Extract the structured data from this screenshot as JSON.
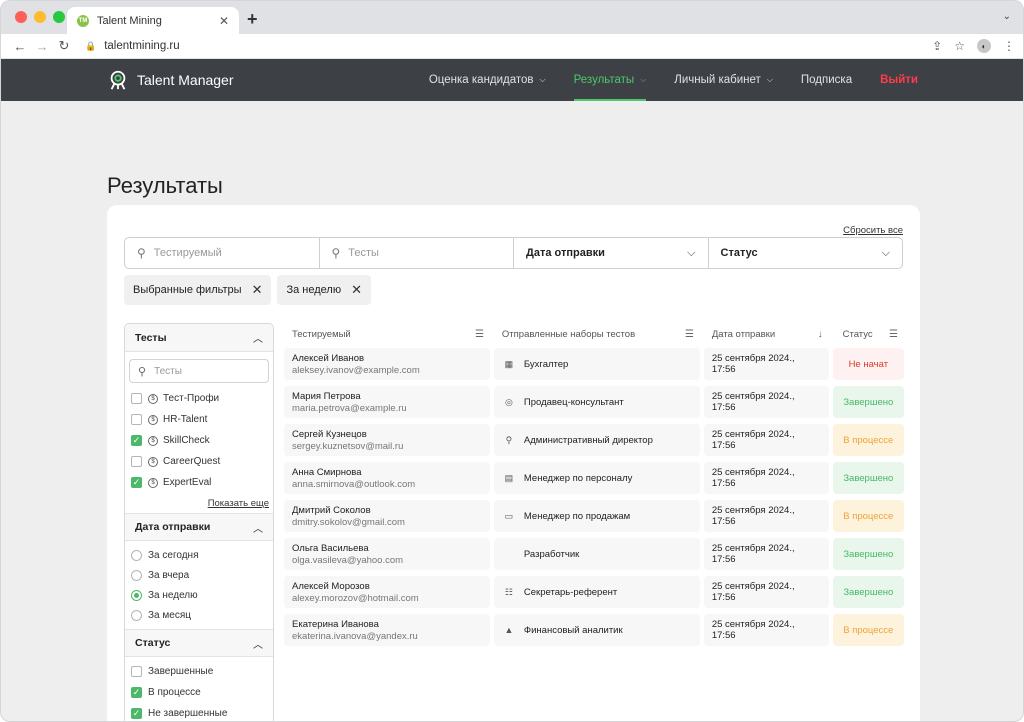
{
  "browser": {
    "tab_title": "Talent Mining",
    "favicon_text": "TM",
    "url": "talentmining.ru"
  },
  "site": {
    "logo_text": "Talent Manager",
    "menu": [
      {
        "label": "Оценка кандидатов",
        "has_chevron": true
      },
      {
        "label": "Результаты",
        "has_chevron": true,
        "active": true
      },
      {
        "label": "Личный кабинет",
        "has_chevron": true
      },
      {
        "label": "Подписка",
        "has_chevron": false
      },
      {
        "label": "Выйти",
        "has_chevron": false
      }
    ]
  },
  "page": {
    "title": "Результаты",
    "reset_all": "Сбросить все"
  },
  "filters": {
    "tested_placeholder": "Тестируемый",
    "tests_placeholder": "Тесты",
    "date_label": "Дата отправки",
    "status_label": "Статус"
  },
  "chips": [
    "Выбранные фильтры",
    "За неделю"
  ],
  "sidebar": {
    "tests_heading": "Тесты",
    "tests_search_placeholder": "Тесты",
    "tests": [
      {
        "label": "Тест-Профи",
        "checked": false
      },
      {
        "label": "HR-Talent",
        "checked": false
      },
      {
        "label": "SkillCheck",
        "checked": true
      },
      {
        "label": "CareerQuest",
        "checked": false
      },
      {
        "label": "ExpertEval",
        "checked": true
      }
    ],
    "show_more": "Показать еще",
    "date_heading": "Дата отправки",
    "dates": [
      {
        "label": "За сегодня",
        "selected": false
      },
      {
        "label": "За вчера",
        "selected": false
      },
      {
        "label": "За неделю",
        "selected": true
      },
      {
        "label": "За месяц",
        "selected": false
      }
    ],
    "status_heading": "Статус",
    "statuses": [
      {
        "label": "Завершенные",
        "checked": false
      },
      {
        "label": "В процессе",
        "checked": true
      },
      {
        "label": "Не завершенные",
        "checked": true
      }
    ]
  },
  "table": {
    "headers": {
      "tested": "Тестируемый",
      "tests": "Отправленные наборы тестов",
      "date": "Дата отправки",
      "status": "Статус"
    },
    "rows": [
      {
        "name": "Алексей Иванов",
        "email": "aleksey.ivanov@example.com",
        "test": "Бухгалтер",
        "icon": "calculator-icon",
        "date": "25 сентября 2024., 17:56",
        "status": "Не начат",
        "status_kind": "not"
      },
      {
        "name": "Мария Петрова",
        "email": "maria.petrova@example.ru",
        "test": "Продавец-консультант",
        "icon": "coin-icon",
        "date": "25 сентября 2024., 17:56",
        "status": "Завершено",
        "status_kind": "done"
      },
      {
        "name": "Сергей Кузнецов",
        "email": "sergey.kuznetsov@mail.ru",
        "test": "Административный директор",
        "icon": "person-icon",
        "date": "25 сентября 2024., 17:56",
        "status": "В процессе",
        "status_kind": "prog"
      },
      {
        "name": "Анна Смирнова",
        "email": "anna.smirnova@outlook.com",
        "test": "Менеджер по персоналу",
        "icon": "folder-icon",
        "date": "25 сентября 2024., 17:56",
        "status": "Завершено",
        "status_kind": "done"
      },
      {
        "name": "Дмитрий Соколов",
        "email": "dmitry.sokolov@gmail.com",
        "test": "Менеджер по продажам",
        "icon": "monitor-icon",
        "date": "25 сентября 2024., 17:56",
        "status": "В процессе",
        "status_kind": "prog"
      },
      {
        "name": "Ольга Васильева",
        "email": "olga.vasileva@yahoo.com",
        "test": "Разработчик",
        "icon": "code-icon",
        "date": "25 сентября 2024., 17:56",
        "status": "Завершено",
        "status_kind": "done"
      },
      {
        "name": "Алексей Морозов",
        "email": "alexey.morozov@hotmail.com",
        "test": "Секретарь-референт",
        "icon": "list-icon",
        "date": "25 сентября 2024., 17:56",
        "status": "Завершено",
        "status_kind": "done"
      },
      {
        "name": "Екатерина Иванова",
        "email": "ekaterina.ivanova@yandex.ru",
        "test": "Финансовый аналитик",
        "icon": "chart-icon",
        "date": "25 сентября 2024., 17:56",
        "status": "В процессе",
        "status_kind": "prog"
      }
    ]
  },
  "colors": {
    "header_bg": "#3d4045",
    "accent_green": "#4cc96b",
    "logout_red": "#ff3b4f"
  }
}
